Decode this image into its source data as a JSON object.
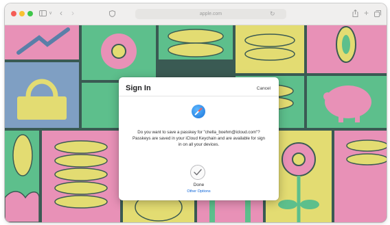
{
  "browser": {
    "url": "apple.com",
    "accent_colors": {
      "close": "#f55d56",
      "minimize": "#f9c132",
      "maximize": "#3ec64a"
    },
    "icons": [
      "sidebar-icon",
      "chevron-down-icon",
      "back-icon",
      "forward-icon",
      "privacy-icon",
      "reload-icon",
      "share-icon",
      "new-tab-icon",
      "tab-overview-icon"
    ]
  },
  "dialog": {
    "title": "Sign In",
    "cancel_label": "Cancel",
    "message": "Do you want to save a passkey for \"chella_boehm@icloud.com\"? Passkeys are saved in your iCloud Keychain and are available for sign in on all your devices.",
    "done_label": "Done",
    "other_options_label": "Other Options",
    "icons": [
      "safari-compass-icon",
      "checkmark-icon"
    ]
  },
  "background": {
    "palette": {
      "pink": "#e891b7",
      "green": "#5dbf8c",
      "yellow": "#e3dc72",
      "blue": "#7f9fc3",
      "outline": "#3a5a53"
    }
  }
}
